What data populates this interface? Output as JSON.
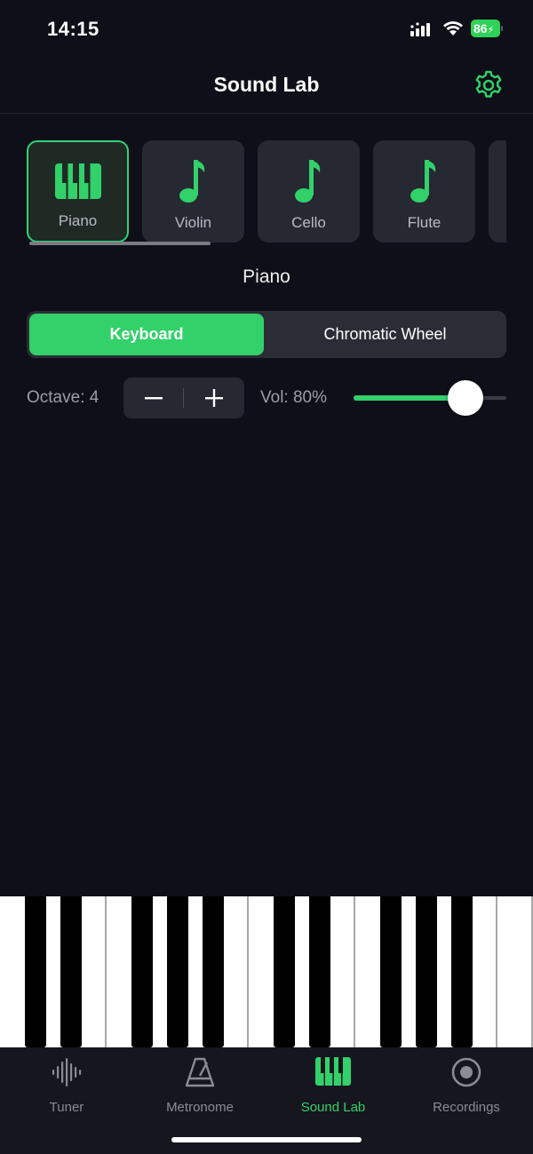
{
  "status": {
    "time": "14:15",
    "battery": "86"
  },
  "header": {
    "title": "Sound Lab"
  },
  "instruments": [
    {
      "label": "Piano",
      "icon": "piano-icon",
      "selected": true
    },
    {
      "label": "Violin",
      "icon": "music-note-icon",
      "selected": false
    },
    {
      "label": "Cello",
      "icon": "music-note-icon",
      "selected": false
    },
    {
      "label": "Flute",
      "icon": "music-note-icon",
      "selected": false
    }
  ],
  "selected_instrument": "Piano",
  "modes": {
    "keyboard": "Keyboard",
    "wheel": "Chromatic Wheel",
    "active": "Keyboard"
  },
  "controls": {
    "octave_label": "Octave: 4",
    "volume_label": "Vol: 80%",
    "volume": 0.8
  },
  "tabs": [
    {
      "label": "Tuner",
      "icon": "waveform-icon"
    },
    {
      "label": "Metronome",
      "icon": "metronome-icon"
    },
    {
      "label": "Sound Lab",
      "icon": "piano-icon",
      "active": true
    },
    {
      "label": "Recordings",
      "icon": "record-icon"
    }
  ],
  "colors": {
    "accent": "#32d16a",
    "background": "#0e0f18",
    "card": "#262832"
  }
}
